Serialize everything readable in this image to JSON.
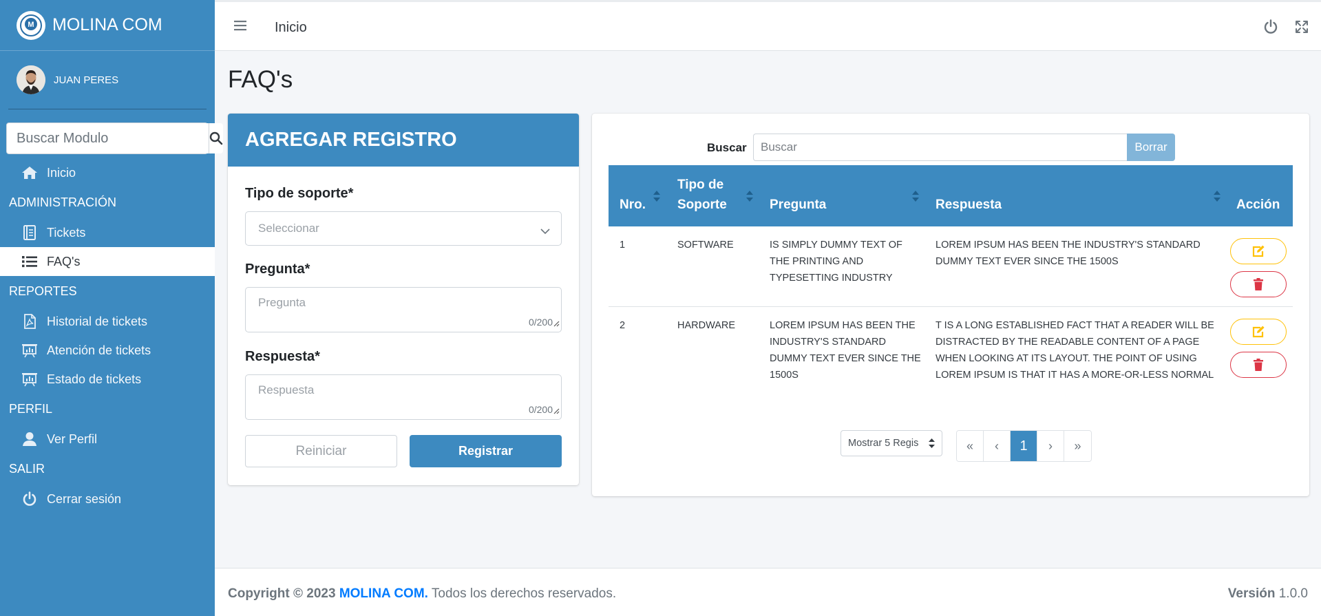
{
  "sidebar": {
    "brand": "MOLINA COM",
    "user": "JUAN PERES",
    "search_placeholder": "Buscar Modulo",
    "items": {
      "inicio": "Inicio",
      "admin_header": "ADMINISTRACIÓN",
      "tickets": "Tickets",
      "faqs": "FAQ's",
      "reportes_header": "REPORTES",
      "historial": "Historial de tickets",
      "atencion": "Atención de tickets",
      "estado": "Estado de tickets",
      "perfil_header": "PERFIL",
      "ver_perfil": "Ver Perfil",
      "salir_header": "SALIR",
      "cerrar": "Cerrar sesión"
    }
  },
  "topbar": {
    "title": "Inicio"
  },
  "page": {
    "title": "FAQ's"
  },
  "form": {
    "title": "AGREGAR REGISTRO",
    "tipo_label": "Tipo de soporte*",
    "tipo_value": "Seleccionar",
    "pregunta_label": "Pregunta*",
    "pregunta_placeholder": "Pregunta",
    "pregunta_counter": "0/200",
    "respuesta_label": "Respuesta*",
    "respuesta_placeholder": "Respuesta",
    "respuesta_counter": "0/200",
    "reset": "Reiniciar",
    "submit": "Registrar"
  },
  "table": {
    "search_label": "Buscar",
    "search_placeholder": "Buscar",
    "clear": "Borrar",
    "headers": {
      "nro": "Nro.",
      "tipo_1": "Tipo de",
      "tipo_2": "Soporte",
      "pregunta": "Pregunta",
      "respuesta": "Respuesta",
      "accion": "Acción"
    },
    "rows": [
      {
        "nro": "1",
        "tipo": "SOFTWARE",
        "pregunta": "IS SIMPLY DUMMY TEXT OF THE PRINTING AND TYPESETTING INDUSTRY",
        "respuesta": "LOREM IPSUM HAS BEEN THE INDUSTRY'S STANDARD DUMMY TEXT EVER SINCE THE 1500S"
      },
      {
        "nro": "2",
        "tipo": "HARDWARE",
        "pregunta": "LOREM IPSUM HAS BEEN THE INDUSTRY'S STANDARD DUMMY TEXT EVER SINCE THE 1500S",
        "respuesta": "T IS A LONG ESTABLISHED FACT THAT A READER WILL BE DISTRACTED BY THE READABLE CONTENT OF A PAGE WHEN LOOKING AT ITS LAYOUT. THE POINT OF USING LOREM IPSUM IS THAT IT HAS A MORE-OR-LESS NORMAL"
      }
    ],
    "page_size": "Mostrar 5 Regis",
    "pager": {
      "first": "«",
      "prev": "‹",
      "current": "1",
      "next": "›",
      "last": "»"
    }
  },
  "footer": {
    "copyright": "Copyright © 2023",
    "brand": "MOLINA COM.",
    "rights": "Todos los derechos reservados.",
    "version_label": "Versión",
    "version": "1.0.0"
  },
  "colors": {
    "primary": "#3d8ac0",
    "edit": "#ffc107",
    "delete": "#dc3545",
    "link": "#007bff"
  }
}
